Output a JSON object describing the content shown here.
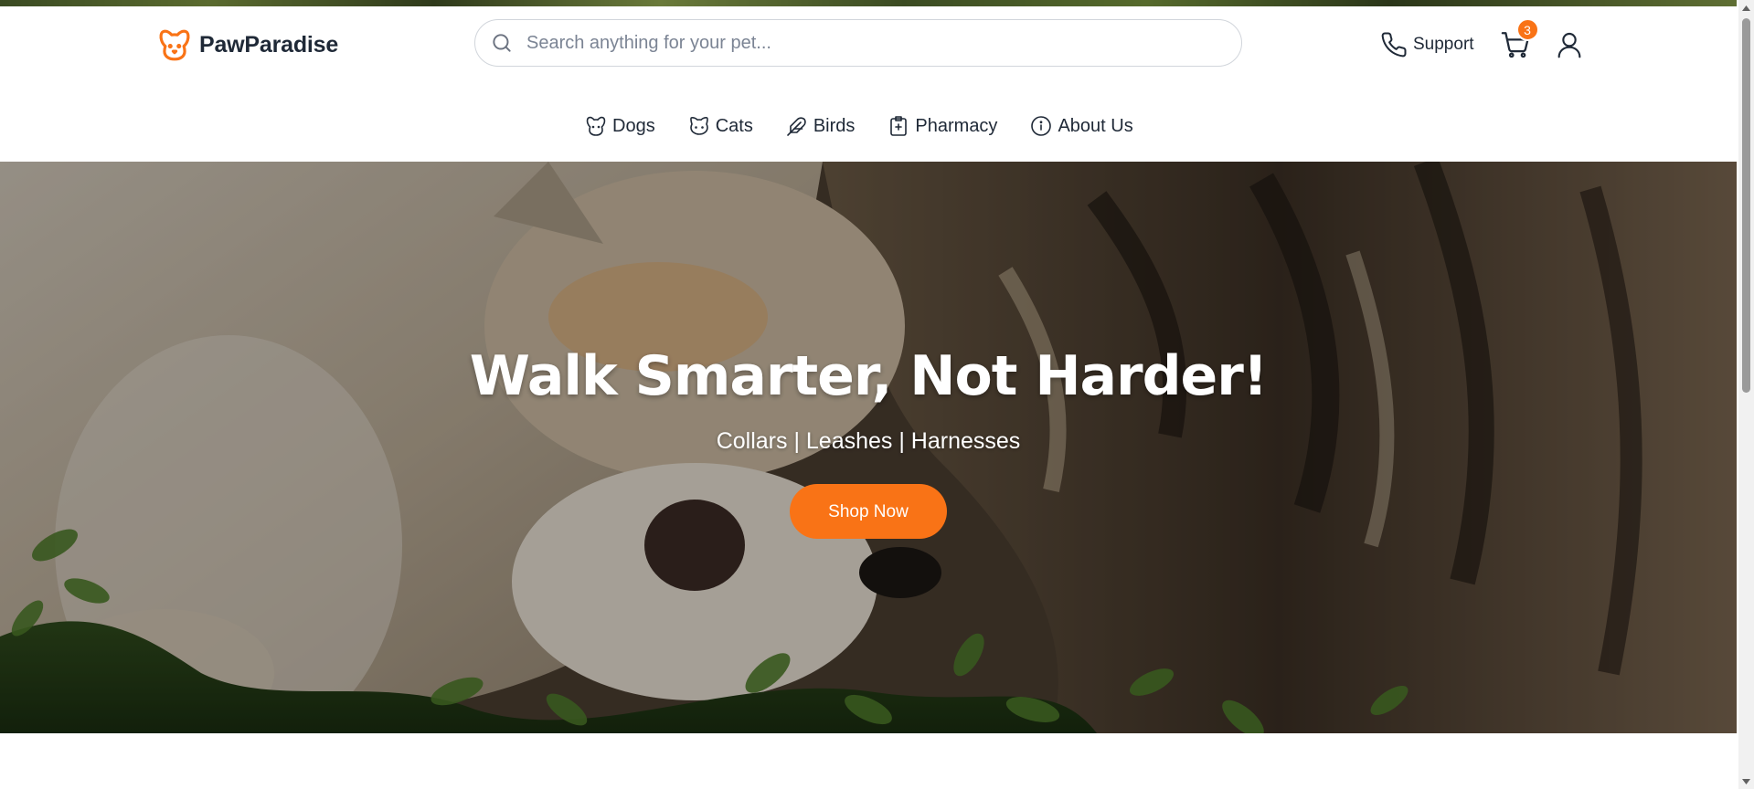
{
  "brand": {
    "name": "PawParadise",
    "accent": "#f97316",
    "logo_icon": "dog-face-icon"
  },
  "search": {
    "placeholder": "Search anything for your pet...",
    "value": "",
    "icon": "search-icon"
  },
  "actions": {
    "support_label": "Support",
    "support_icon": "phone-icon",
    "cart_icon": "cart-icon",
    "cart_count": "3",
    "user_icon": "user-icon"
  },
  "nav": {
    "items": [
      {
        "label": "Dogs",
        "icon": "dog-icon"
      },
      {
        "label": "Cats",
        "icon": "cat-icon"
      },
      {
        "label": "Birds",
        "icon": "bird-icon"
      },
      {
        "label": "Pharmacy",
        "icon": "pharmacy-icon"
      },
      {
        "label": "About Us",
        "icon": "info-icon"
      }
    ]
  },
  "hero": {
    "title": "Walk Smarter, Not Harder!",
    "subtitle": "Collars | Leashes | Harnesses",
    "button_label": "Shop Now",
    "button_color": "#f97316"
  }
}
